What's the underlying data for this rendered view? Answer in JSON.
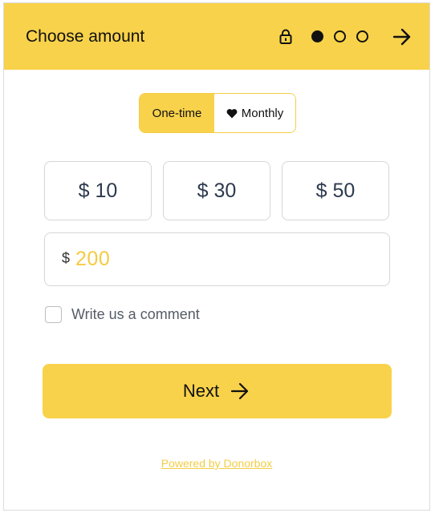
{
  "header": {
    "title": "Choose amount",
    "steps": [
      {
        "state": "active"
      },
      {
        "state": "inactive"
      },
      {
        "state": "inactive"
      }
    ],
    "icons": {
      "lock": "lock-icon",
      "next": "arrow-right-icon"
    }
  },
  "frequency": {
    "options": [
      {
        "label": "One-time",
        "selected": true
      },
      {
        "label": "Monthly",
        "selected": false,
        "icon": "heart-icon"
      }
    ]
  },
  "amounts": [
    {
      "label": "$ 10"
    },
    {
      "label": "$ 30"
    },
    {
      "label": "$ 50"
    }
  ],
  "custom_amount": {
    "currency": "$",
    "value": "200"
  },
  "comment": {
    "label": "Write us a comment",
    "checked": false
  },
  "next_button": {
    "label": "Next",
    "icon": "arrow-right-icon"
  },
  "footer": {
    "powered_by": "Powered by Donorbox"
  },
  "colors": {
    "accent": "#f8d24a",
    "amount_text": "#2d3a4e",
    "custom_value": "#f5cb42"
  }
}
